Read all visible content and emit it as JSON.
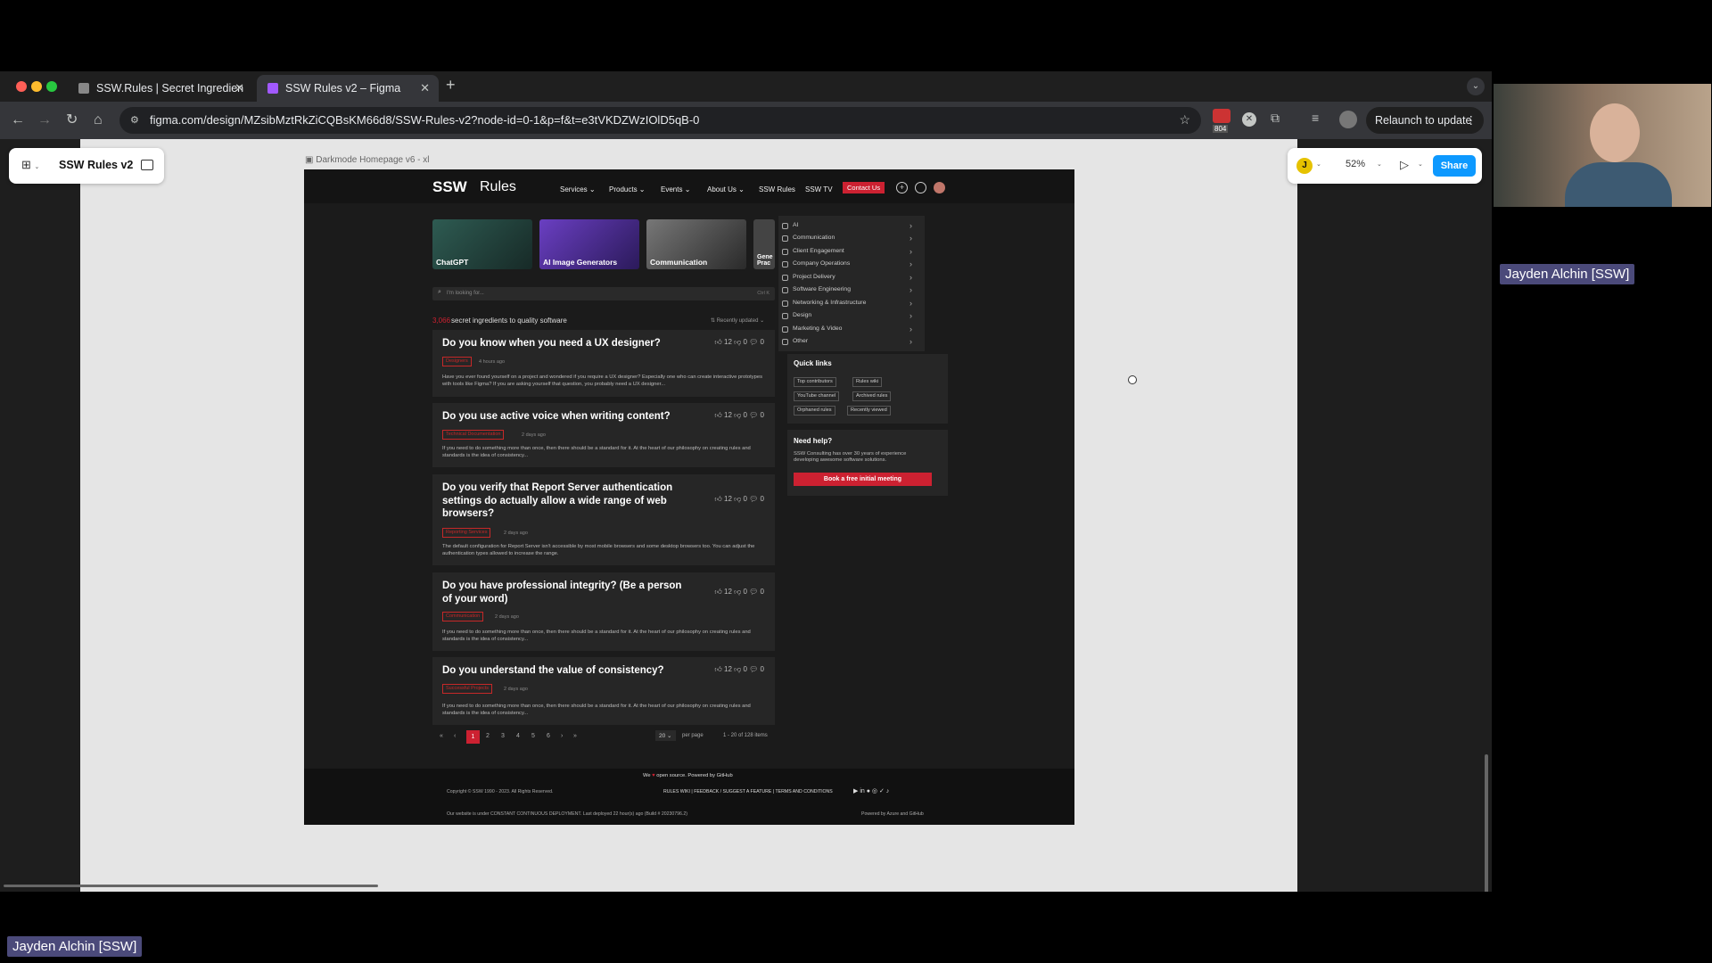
{
  "browser": {
    "tabs": [
      {
        "title": "SSW.Rules | Secret Ingredien",
        "active": false
      },
      {
        "title": "SSW Rules v2 – Figma",
        "active": true
      }
    ],
    "url": "figma.com/design/MZsibMztRkZiCQBsKM66d8/SSW-Rules-v2?node-id=0-1&p=f&t=e3tVKDZWzIOlD5qB-0",
    "extension_badge": "804",
    "relaunch_label": "Relaunch to update"
  },
  "figma": {
    "file_name": "SSW Rules v2",
    "zoom": "52%",
    "share_label": "Share",
    "user_initial": "J",
    "frame_label": "Darkmode Homepage v6 - xl",
    "help": "?"
  },
  "design": {
    "logo_main": "SSW",
    "logo_sub": "Rules",
    "nav": [
      "Services",
      "Products",
      "Events",
      "About Us",
      "SSW Rules",
      "SSW TV"
    ],
    "contact": "Contact Us",
    "categories_cards": [
      "ChatGPT",
      "AI Image Generators",
      "Communication",
      "Gene Prac"
    ],
    "search_placeholder": "I'm looking for...",
    "search_shortcut": "Ctrl K",
    "count": "3,066",
    "count_text": "secret ingredients to quality software",
    "sort": "Recently updated",
    "rules": [
      {
        "title": "Do you know when you need a UX designer?",
        "tag": "Designers",
        "ago": "4 hours ago",
        "excerpt": "Have you ever found yourself on a project and wondered if you require a UX designer? Especially one who can create interactive prototypes with tools like Figma? If you are asking yourself that question, you probably need a UX designer...",
        "likes": "12",
        "dislikes": "0",
        "comments": "0"
      },
      {
        "title": "Do you use active voice when writing content?",
        "tag": "Technical Documentation",
        "ago": "2 days ago",
        "excerpt": "If you need to do something more than once, then there should be a standard for it. At the heart of our philosophy on creating rules and standards is the idea of consistency...",
        "likes": "12",
        "dislikes": "0",
        "comments": "0"
      },
      {
        "title": "Do you verify that Report Server authentication settings do actually allow a wide range of web browsers?",
        "tag": "Reporting Services",
        "ago": "2 days ago",
        "excerpt": "The default configuration for Report Server isn't accessible by most mobile browsers and some desktop browsers too. You can adjust the authentication types allowed to increase the range.",
        "likes": "12",
        "dislikes": "0",
        "comments": "0"
      },
      {
        "title": "Do you have professional integrity? (Be a person of your word)",
        "tag": "Communication",
        "ago": "2 days ago",
        "excerpt": "If you need to do something more than once, then there should be a standard for it. At the heart of our philosophy on creating rules and standards is the idea of consistency...",
        "likes": "12",
        "dislikes": "0",
        "comments": "0"
      },
      {
        "title": "Do you understand the value of consistency?",
        "tag": "Successful Projects",
        "ago": "2 days ago",
        "excerpt": "If you need to do something more than once, then there should be a standard for it. At the heart of our philosophy on creating rules and standards is the idea of consistency...",
        "likes": "12",
        "dislikes": "0",
        "comments": "0"
      }
    ],
    "categories": [
      "AI",
      "Communication",
      "Client Engagement",
      "Company Operations",
      "Project Delivery",
      "Software Engineering",
      "Networking & Infrastructure",
      "Design",
      "Marketing & Video",
      "Other"
    ],
    "quick_links_title": "Quick links",
    "quick_links": [
      "Top contributors",
      "Rules wiki",
      "YouTube channel",
      "Archived rules",
      "Orphaned rules",
      "Recently viewed"
    ],
    "help_title": "Need help?",
    "help_text": "SSW Consulting has over 30 years of experience developing awesome software solutions.",
    "help_button": "Book a free initial meeting",
    "pagination": {
      "pages": [
        "1",
        "2",
        "3",
        "4",
        "5",
        "6"
      ],
      "current": "1",
      "per_page_value": "20",
      "per_page_label": "per page",
      "range": "1 - 20 of 128 items"
    },
    "footer": {
      "love_pre": "We",
      "love_post": "open source. Powered by GitHub",
      "copyright": "Copyright © SSW 1990 - 2023. All Rights Reserved.",
      "links": "RULES WIKI  |  FEEDBACK / SUGGEST A FEATURE  |  TERMS AND CONDITIONS",
      "deploy": "Our website is under CONSTANT CONTINUOUS DEPLOYMENT. Last deployed 22 hour(s) ago (Build # 20230796.2)",
      "powered": "Powered by Azure and GitHub"
    }
  },
  "meeting": {
    "participant": "Jayden Alchin [SSW]"
  },
  "colors": {
    "accent": "#cc2131",
    "figma_blue": "#0d99ff",
    "badge": "#4b4a7a"
  }
}
